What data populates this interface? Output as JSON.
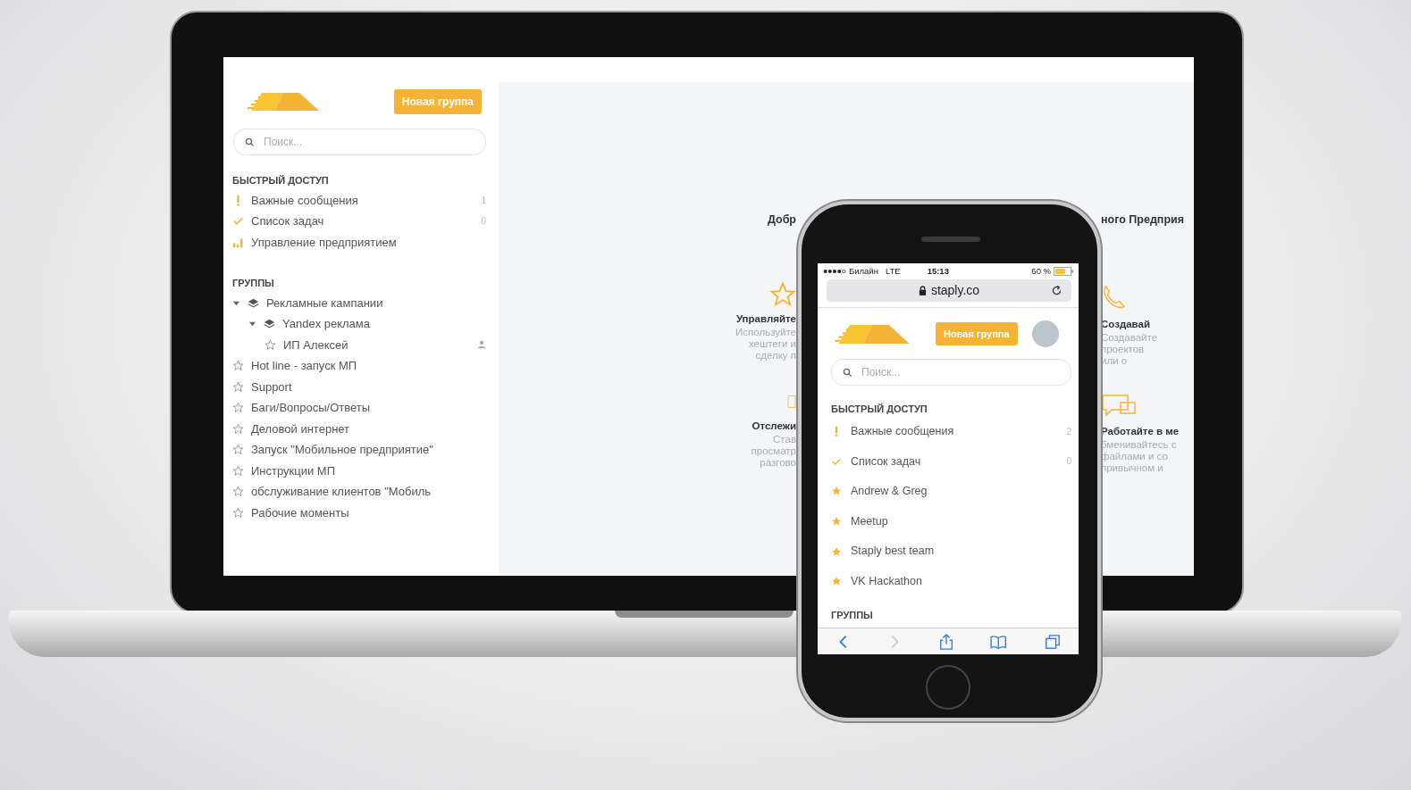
{
  "desktop": {
    "new_group_button": "Новая группа",
    "search": {
      "placeholder": "Поиск..."
    },
    "quick_access": {
      "title": "БЫСТРЫЙ ДОСТУП",
      "items": [
        {
          "kind": "important",
          "label": "Важные сообщения",
          "count": "1"
        },
        {
          "kind": "tasks",
          "label": "Список задач",
          "count": "0"
        },
        {
          "kind": "chart",
          "label": "Управление предприятием"
        }
      ]
    },
    "groups": {
      "title": "ГРУППЫ",
      "items": [
        {
          "kind": "folder",
          "label": "Рекламные кампании",
          "expanded": true,
          "children": [
            {
              "kind": "folder",
              "label": "Yandex реклама",
              "expanded": true,
              "children": [
                {
                  "kind": "group",
                  "label": "ИП Алексей",
                  "shared": true
                }
              ]
            }
          ]
        },
        {
          "kind": "group",
          "label": "Hot line - запуск МП",
          "shared": false
        },
        {
          "kind": "group",
          "label": "Support",
          "shared": false
        },
        {
          "kind": "group",
          "label": "Баги/Вопросы/Ответы",
          "shared": false
        },
        {
          "kind": "group",
          "label": "Деловой интернет",
          "shared": false
        },
        {
          "kind": "group",
          "label": "Запуск \"Мобильное предприятие\"",
          "shared": false
        },
        {
          "kind": "group",
          "label": "Инструкции МП",
          "shared": false
        },
        {
          "kind": "group",
          "label": "обслуживание клиентов \"Мобиль",
          "shared": false
        },
        {
          "kind": "group",
          "label": "Рабочие моменты",
          "shared": false
        }
      ]
    },
    "main": {
      "heading_left": "Добр",
      "heading_right": "ного Предприя",
      "features_left": [
        {
          "kind": "star",
          "title": "Управляйте",
          "lines": [
            "Используйте",
            "хештеги и",
            "сделку п"
          ]
        },
        {
          "kind": "clipboard",
          "title": "Отслежи",
          "lines": [
            "Став",
            "просматр",
            "разгово"
          ]
        }
      ],
      "features_right": [
        {
          "kind": "phone",
          "title": "Создавай",
          "lines": [
            "Создавайте",
            "проектов",
            "или о"
          ]
        },
        {
          "kind": "chat",
          "title": "Работайте в ме",
          "lines": [
            "бменивайтесь с",
            "файлами и со",
            "привычном и"
          ]
        }
      ]
    }
  },
  "phone": {
    "status": {
      "carrier": "Билайн",
      "network": "LTE",
      "time": "15:13",
      "battery": "60 %"
    },
    "url": "staply.co",
    "new_group_button": "Новая группа",
    "search": {
      "placeholder": "Поиск..."
    },
    "quick_access": {
      "title": "БЫСТРЫЙ ДОСТУП",
      "items": [
        {
          "kind": "important",
          "label": "Важные сообщения",
          "count": "2"
        },
        {
          "kind": "tasks",
          "label": "Список задач",
          "count": "0"
        },
        {
          "kind": "favorite",
          "label": "Andrew & Greg"
        },
        {
          "kind": "favorite",
          "label": "Meetup"
        },
        {
          "kind": "favorite",
          "label": "Staply best team"
        },
        {
          "kind": "favorite",
          "label": "VK Hackathon"
        }
      ]
    },
    "groups_title": "ГРУППЫ",
    "toolbar": [
      {
        "kind": "back",
        "disabled": false
      },
      {
        "kind": "forward",
        "disabled": true
      },
      {
        "kind": "share",
        "disabled": false
      },
      {
        "kind": "bookmarks",
        "disabled": false
      },
      {
        "kind": "tabs",
        "disabled": false
      }
    ]
  }
}
